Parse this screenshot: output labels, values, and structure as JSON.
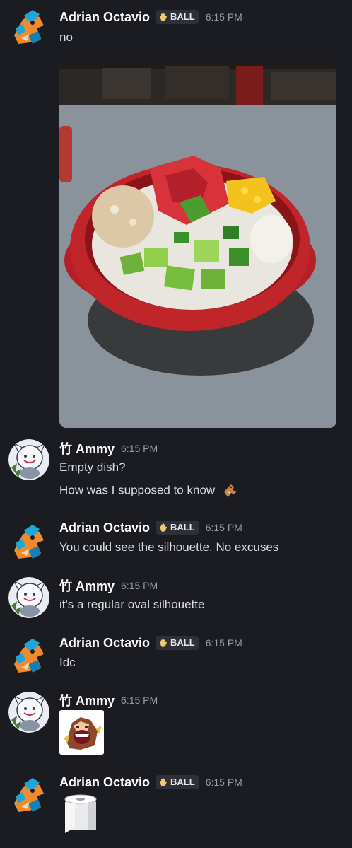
{
  "messages": [
    {
      "author": "Adrian Octavio",
      "tag": "BALL",
      "time": "6:15 PM",
      "lines": [
        "no"
      ]
    },
    {
      "author": "竹 Ammy",
      "time": "6:15 PM",
      "lines": [
        "Empty dish?",
        "How was I supposed to know"
      ]
    },
    {
      "author": "Adrian Octavio",
      "tag": "BALL",
      "time": "6:15 PM",
      "lines": [
        "You could see the silhouette. No excuses"
      ]
    },
    {
      "author": "竹 Ammy",
      "time": "6:15 PM",
      "lines": [
        "it's a regular oval silhouette"
      ]
    },
    {
      "author": "Adrian Octavio",
      "tag": "BALL",
      "time": "6:15 PM",
      "lines": [
        "Idc"
      ]
    },
    {
      "author": "竹 Ammy",
      "time": "6:15 PM",
      "lines": []
    },
    {
      "author": "Adrian Octavio",
      "tag": "BALL",
      "time": "6:15 PM",
      "lines": []
    }
  ],
  "icons": {
    "adrian_avatar": "blue-dragon-avatar-icon",
    "ammy_avatar": "white-wolf-avatar-icon",
    "tag_icon": "hand-icon",
    "emoji": "gingerbread-emoji-icon",
    "sticker_1": "shouting-creature-sticker-icon",
    "sticker_2": "toilet-paper-sticker-icon"
  },
  "colors": {
    "background": "#1b1c21",
    "text": "#dcdde1",
    "name": "#ffffff",
    "timestamp": "#9a9ca4",
    "tag_bg": "#2e3038"
  }
}
